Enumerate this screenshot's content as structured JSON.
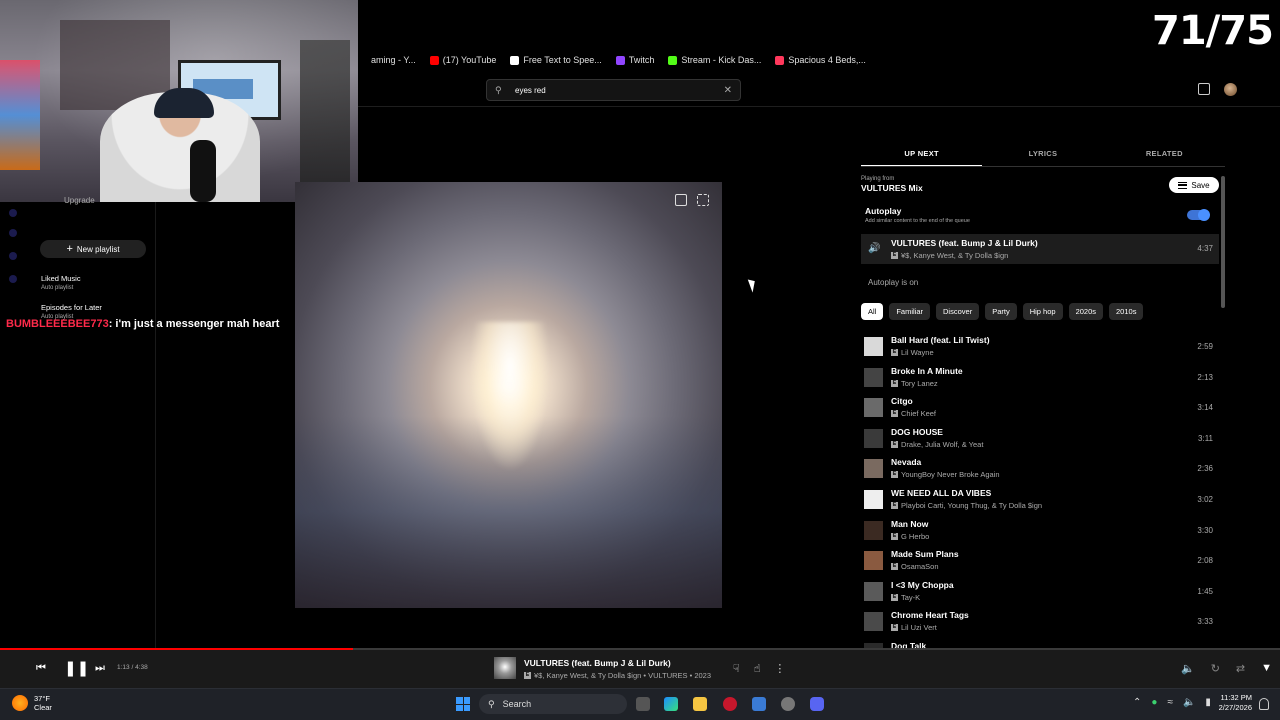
{
  "overlay": {
    "counter": "71/75"
  },
  "bookmarks": [
    {
      "label": "aming - Y...",
      "color": "#000000"
    },
    {
      "label": "(17) YouTube",
      "color": "#ff0000"
    },
    {
      "label": "Free Text to Spee...",
      "color": "#ffffff"
    },
    {
      "label": "Twitch",
      "color": "#9146ff"
    },
    {
      "label": "Stream - Kick Das...",
      "color": "#53fc18"
    },
    {
      "label": "Spacious 4 Beds,...",
      "color": "#ff385c"
    }
  ],
  "search": {
    "value": "eyes red"
  },
  "sidebar": {
    "upgrade_label": "Upgrade",
    "new_playlist_label": "New playlist",
    "playlists": [
      {
        "name": "Liked Music",
        "sub": "Auto playlist"
      },
      {
        "name": "Episodes for Later",
        "sub": "Auto playlist"
      }
    ]
  },
  "chat": {
    "user": "BUMBLEEEBEE773",
    "message": ": i'm just a messenger mah heart"
  },
  "panel": {
    "tabs": [
      "UP NEXT",
      "LYRICS",
      "RELATED"
    ],
    "playing_from_label": "Playing from",
    "playing_from_name": "VULTURES Mix",
    "save_label": "Save",
    "autoplay_title": "Autoplay",
    "autoplay_desc": "Add similar content to the end of the queue",
    "autoplay_enabled": true,
    "now_playing": {
      "title": "VULTURES (feat. Bump J & Lil Durk)",
      "artist": "¥$, Kanye West, & Ty Dolla $ign",
      "duration": "4:37"
    },
    "autoplay_status": "Autoplay is on",
    "chips": [
      "All",
      "Familiar",
      "Discover",
      "Party",
      "Hip hop",
      "2020s",
      "2010s"
    ],
    "queue": [
      {
        "title": "Ball Hard (feat. Lil Twist)",
        "artist": "Lil Wayne",
        "duration": "2:59",
        "thumb": "#d9d9d9"
      },
      {
        "title": "Broke In A Minute",
        "artist": "Tory Lanez",
        "duration": "2:13",
        "thumb": "#444444"
      },
      {
        "title": "Citgo",
        "artist": "Chief Keef",
        "duration": "3:14",
        "thumb": "#6a6a6a"
      },
      {
        "title": "DOG HOUSE",
        "artist": "Drake, Julia Wolf, & Yeat",
        "duration": "3:11",
        "thumb": "#3a3a3a"
      },
      {
        "title": "Nevada",
        "artist": "YoungBoy Never Broke Again",
        "duration": "2:36",
        "thumb": "#7a6a60"
      },
      {
        "title": "WE NEED ALL DA VIBES",
        "artist": "Playboi Carti, Young Thug, & Ty Dolla $ign",
        "duration": "3:02",
        "thumb": "#eeeeee"
      },
      {
        "title": "Man Now",
        "artist": "G Herbo",
        "duration": "3:30",
        "thumb": "#3b2a22"
      },
      {
        "title": "Made Sum Plans",
        "artist": "OsamaSon",
        "duration": "2:08",
        "thumb": "#8a5a40"
      },
      {
        "title": "I <3 My Choppa",
        "artist": "Tay-K",
        "duration": "1:45",
        "thumb": "#5a5a5a"
      },
      {
        "title": "Chrome Heart Tags",
        "artist": "Lil Uzi Vert",
        "duration": "3:33",
        "thumb": "#4a4a4a"
      },
      {
        "title": "Dog Talk",
        "artist": "",
        "duration": "",
        "thumb": "#2a2a2a"
      }
    ]
  },
  "player": {
    "time": "1:13 / 4:38",
    "progress": 0.276,
    "title": "VULTURES (feat. Bump J & Lil Durk)",
    "subtitle": "¥$, Kanye West, & Ty Dolla $ign • VULTURES • 2023",
    "accent": "#ff0000"
  },
  "taskbar": {
    "temp": "37°F",
    "condition": "Clear",
    "search_label": "Search",
    "time": "11:32 PM",
    "date": "2/27/2026"
  }
}
